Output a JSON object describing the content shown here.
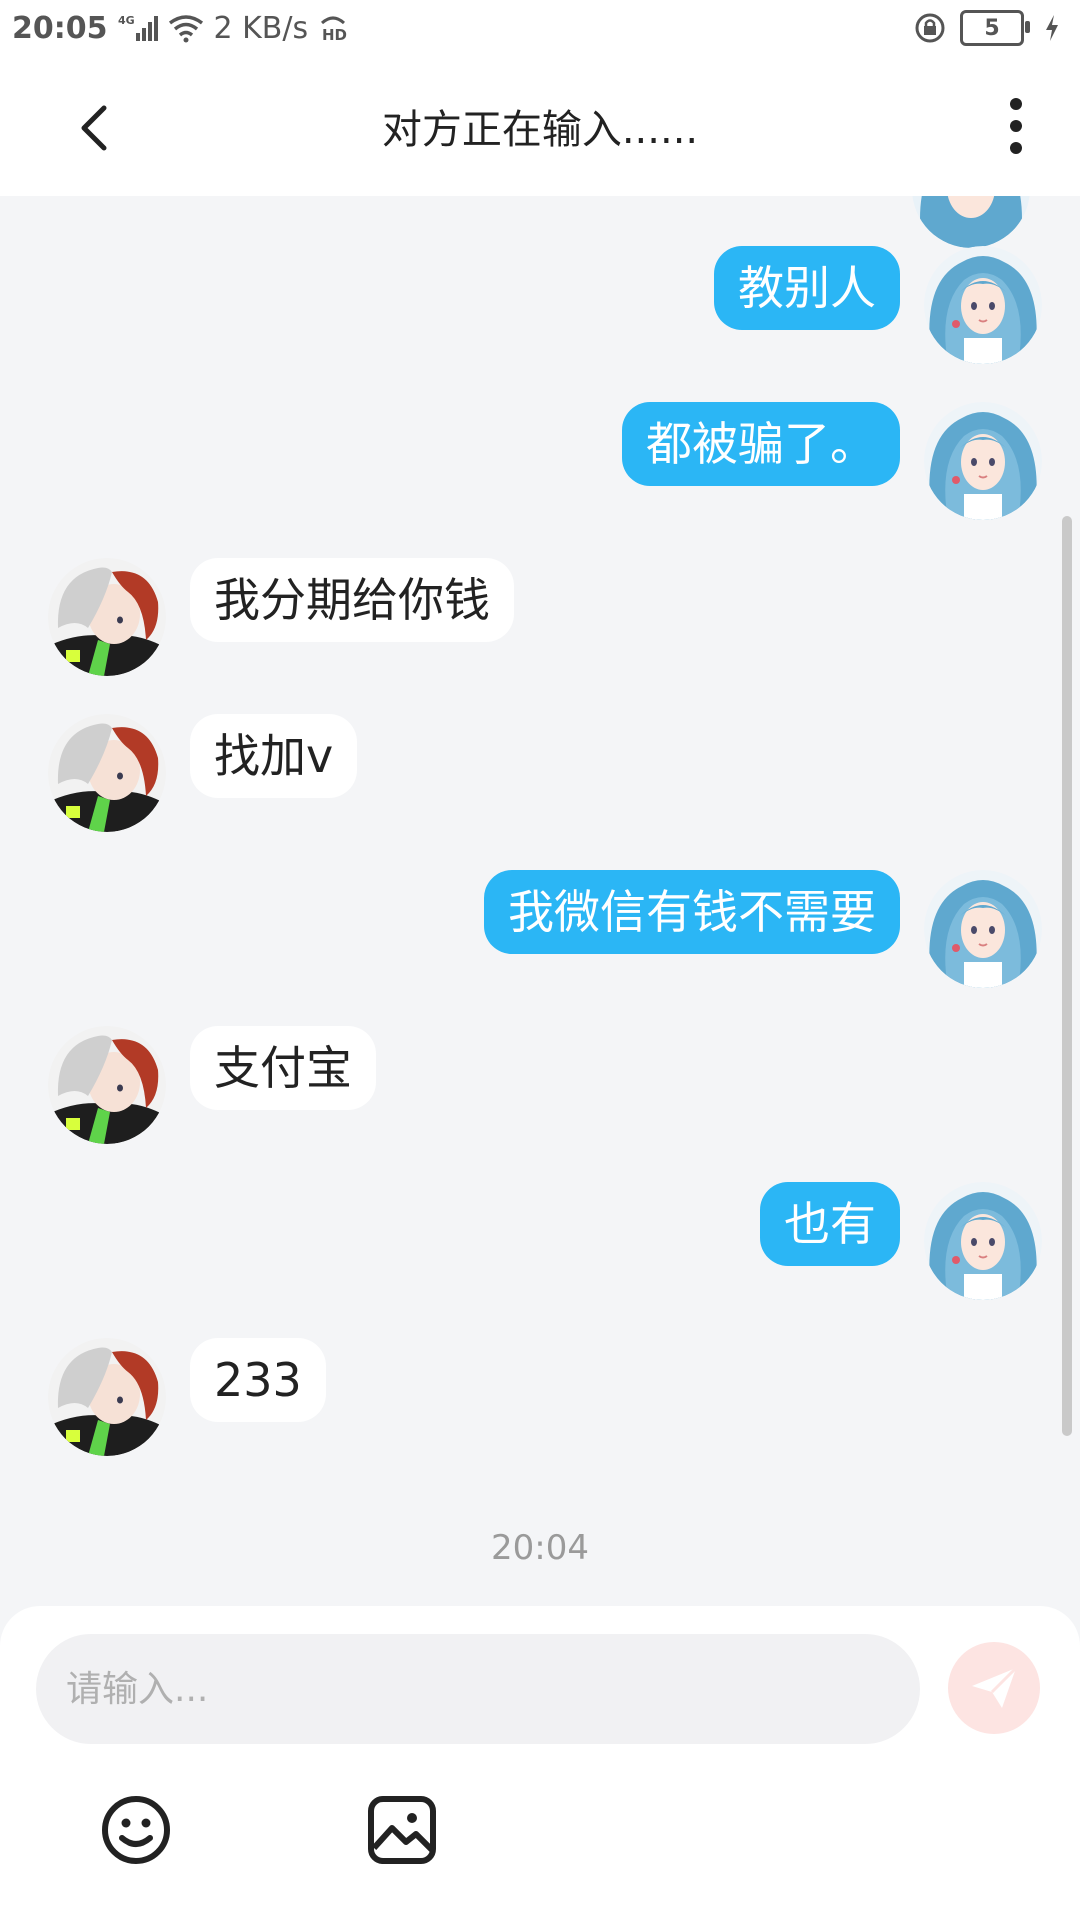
{
  "status_bar": {
    "time": "20:05",
    "network": "4G",
    "speed": "2 KB/s",
    "battery": "5",
    "icons": [
      "signal-icon",
      "wifi-icon",
      "hd-icon",
      "lock-rotation-icon",
      "battery-icon",
      "charging-icon"
    ]
  },
  "header": {
    "title": "对方正在输入......",
    "back_icon": "chevron-left-icon",
    "more_icon": "more-vertical-icon"
  },
  "messages": [
    {
      "from": "me",
      "text": "教别人"
    },
    {
      "from": "me",
      "text": "都被骗了。"
    },
    {
      "from": "them",
      "text": "我分期给你钱"
    },
    {
      "from": "them",
      "text": "找加v"
    },
    {
      "from": "me",
      "text": "我微信有钱不需要"
    },
    {
      "from": "them",
      "text": "支付宝"
    },
    {
      "from": "me",
      "text": "也有"
    },
    {
      "from": "them",
      "text": "233"
    }
  ],
  "timestamp": "20:04",
  "composer": {
    "placeholder": "请输入...",
    "send_icon": "send-icon",
    "emoji_icon": "smile-icon",
    "image_icon": "image-icon"
  },
  "colors": {
    "my_bubble": "#2bb6f5",
    "their_bubble": "#ffffff",
    "background": "#f4f5f7",
    "send_button": "#fde4e2"
  }
}
